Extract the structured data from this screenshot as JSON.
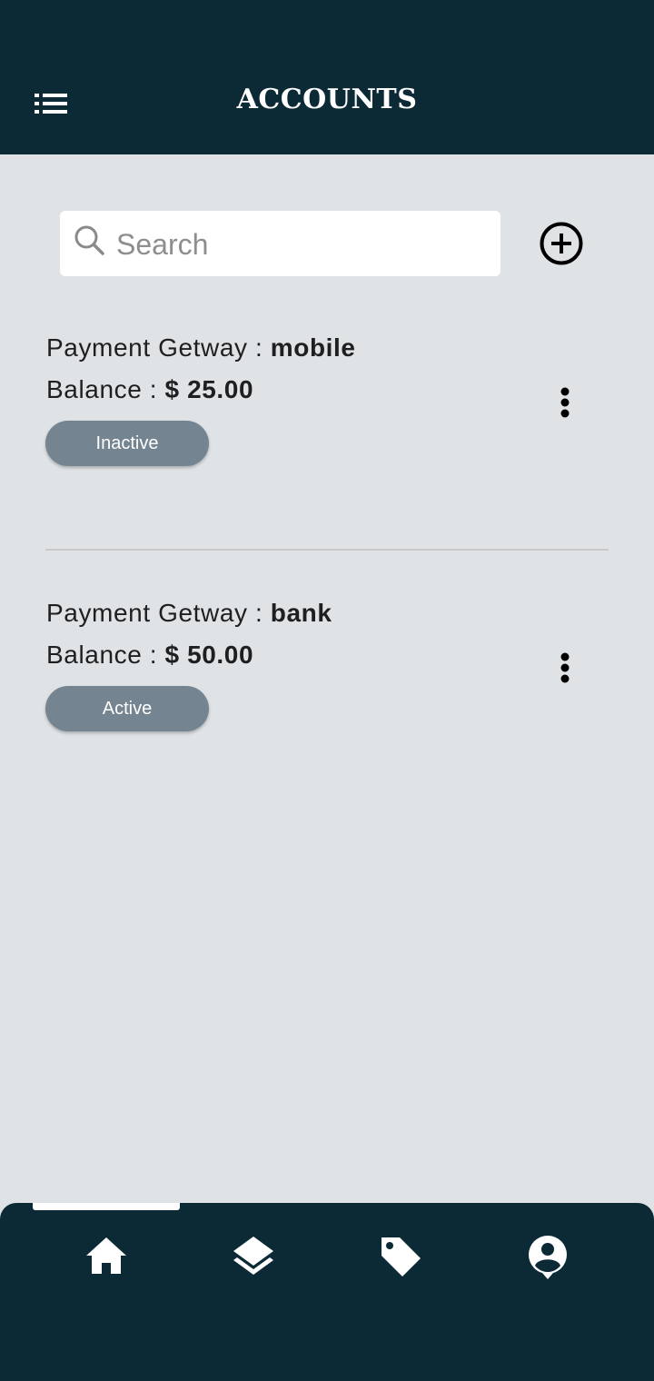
{
  "header": {
    "title": "ACCOUNTS",
    "menu_icon": "list-menu-icon"
  },
  "search": {
    "placeholder": "Search",
    "value": "",
    "icon": "search-icon"
  },
  "add_button": {
    "icon": "plus-circle-icon"
  },
  "accounts": [
    {
      "gateway_label": "Payment Getway : ",
      "gateway": "mobile",
      "balance_label": "Balance : ",
      "balance": "$ 25.00",
      "status": "Inactive"
    },
    {
      "gateway_label": "Payment Getway : ",
      "gateway": "bank",
      "balance_label": "Balance : ",
      "balance": "$ 50.00",
      "status": "Active"
    }
  ],
  "bottom_nav": {
    "active_index": 0,
    "items": [
      {
        "icon": "home-icon"
      },
      {
        "icon": "layers-icon"
      },
      {
        "icon": "tag-icon"
      },
      {
        "icon": "account-circle-icon"
      }
    ]
  },
  "colors": {
    "header_bg": "#0b2a36",
    "page_bg": "#dfe3e6",
    "status_button": "#748591"
  }
}
